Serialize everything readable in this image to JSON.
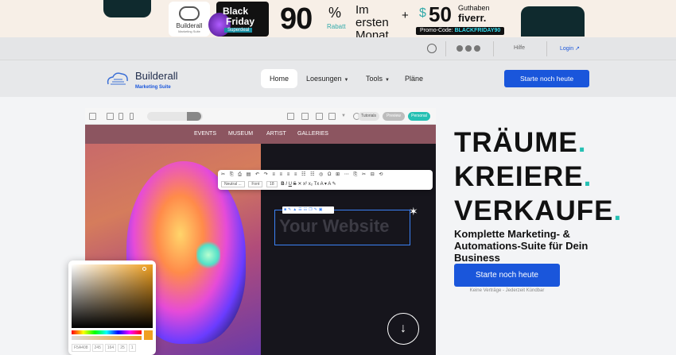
{
  "banner": {
    "brand_name": "Builderall",
    "brand_sub": "Marketing Suite",
    "bf_line1": "Black",
    "bf_line2": "Friday",
    "bf_tag": "Superdeal",
    "discount": "90",
    "percent": "%",
    "rabatt": "Rabatt",
    "im_ersten_monat": "Im ersten Monat",
    "plus": "+",
    "dollar": "$",
    "credit": "50",
    "guthaben": "Guthaben",
    "partner": "fiverr.",
    "promo_label": "Promo-Code:",
    "promo_code": "BLACKFRIDAY90"
  },
  "topbar": {
    "icons": [
      "globe-icon",
      "youtube-icon",
      "facebook-icon",
      "instagram-icon"
    ],
    "help": "Hilfe",
    "login": "Login ↗"
  },
  "nav": {
    "logo_name": "Builderall",
    "logo_sub": "Marketing Suite",
    "items": [
      {
        "label": "Home",
        "active": true
      },
      {
        "label": "Loesungen",
        "dropdown": true
      },
      {
        "label": "Tools",
        "dropdown": true
      },
      {
        "label": "Pläne"
      }
    ],
    "cta": "Starte noch heute"
  },
  "mockup": {
    "pills": [
      "Tutorials",
      "Preview",
      "Personal"
    ],
    "menu": [
      "EVENTS",
      "MUSEUM",
      "ARTIST",
      "GALLERIES"
    ],
    "font_select": "Neutral ...",
    "font_label": "Font",
    "size_value": "18",
    "text_placeholder": "Your Website",
    "picker_values": [
      "F5A408",
      "245",
      "164",
      "25",
      "1"
    ]
  },
  "hero": {
    "line1": "TRÄUME",
    "line2": "KREIERE",
    "line3": "VERKAUFE",
    "dot": ".",
    "subtitle": "Komplette Marketing- & Automations-Suite für Dein Business",
    "cta": "Starte noch heute",
    "note": "Keine Verträge - Jederzeit Kündbar"
  },
  "colors": {
    "accent": "#1a56db",
    "teal": "#25c0b3"
  }
}
